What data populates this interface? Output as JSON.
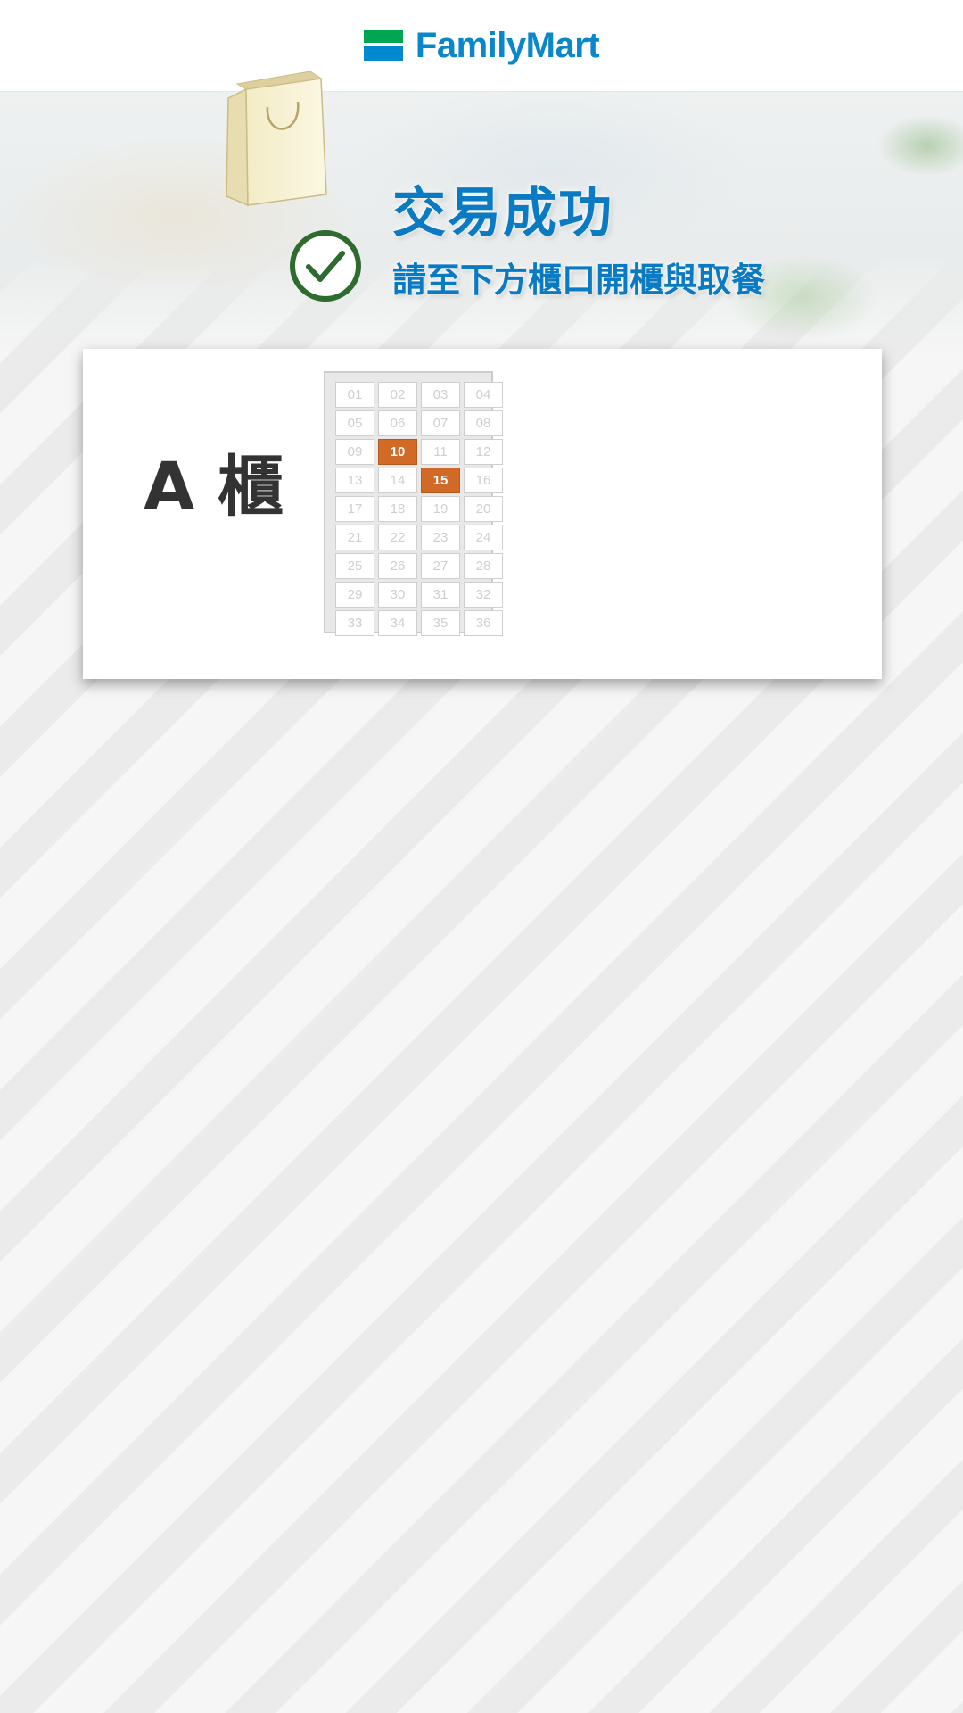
{
  "header": {
    "brand": "FamilyMart",
    "colors": {
      "brand_blue": "#0a87c9",
      "stripe_green": "#00a651",
      "stripe_blue": "#0089cf"
    }
  },
  "hero": {
    "title": "交易成功",
    "subtitle": "請至下方櫃口開櫃與取餐",
    "icons": [
      "shopping-bag-icon",
      "check-circle-icon"
    ],
    "colors": {
      "title": "#0a7bc2",
      "check": "#2e6b2e"
    }
  },
  "locker": {
    "cabinet_label": "A 櫃",
    "cells": [
      "01",
      "02",
      "03",
      "04",
      "05",
      "06",
      "07",
      "08",
      "09",
      "10",
      "11",
      "12",
      "13",
      "14",
      "15",
      "16",
      "17",
      "18",
      "19",
      "20",
      "21",
      "22",
      "23",
      "24",
      "25",
      "26",
      "27",
      "28",
      "29",
      "30",
      "31",
      "32",
      "33",
      "34",
      "35",
      "36"
    ],
    "active_cells": [
      "10",
      "15"
    ],
    "colors": {
      "active": "#d06a26"
    }
  }
}
